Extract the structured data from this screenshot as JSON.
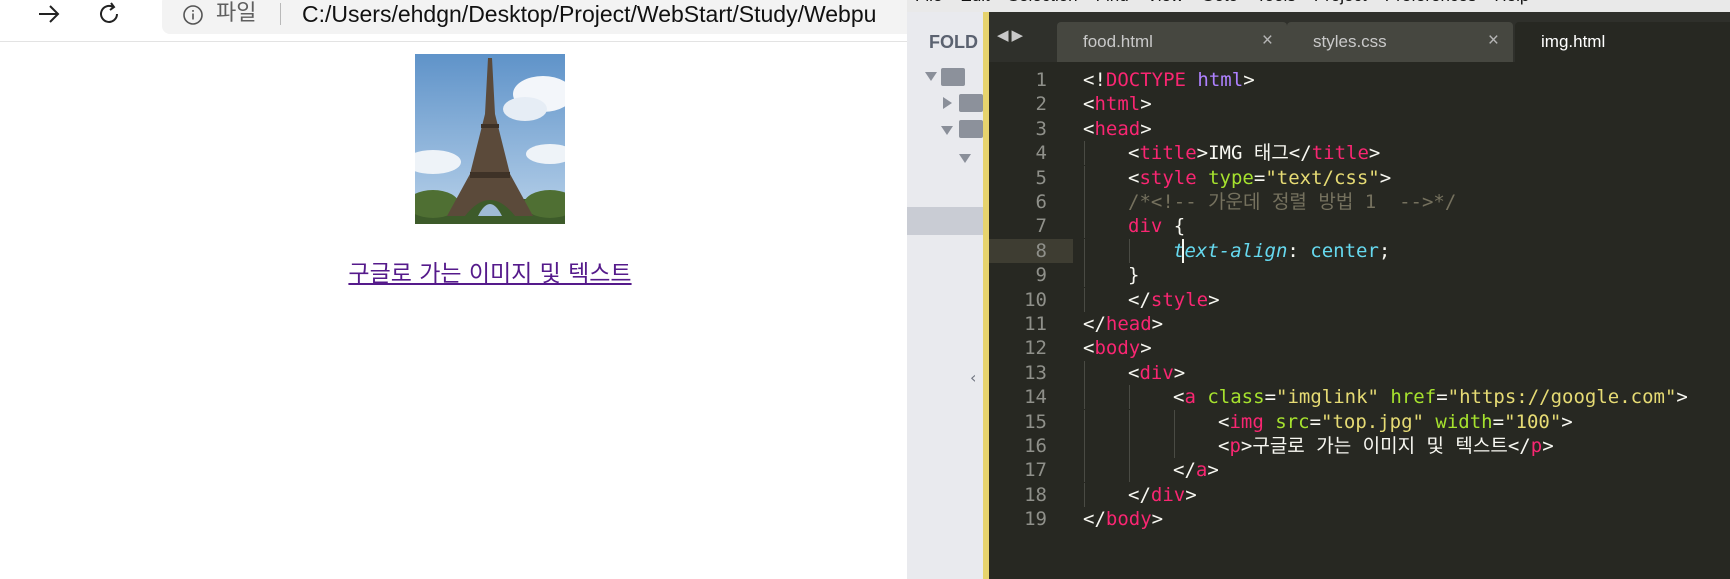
{
  "browser": {
    "address_scheme": "파일",
    "address_url": "C:/Users/ehdgn/Desktop/Project/WebStart/Study/Webpu",
    "page": {
      "image_alt": "Eiffel Tower photo",
      "link_text": "구글로 가는 이미지 및 텍스트"
    }
  },
  "editor": {
    "menu": [
      "File",
      "Edit",
      "Selection",
      "Find",
      "View",
      "Goto",
      "Tools",
      "Project",
      "Preferences",
      "Help"
    ],
    "sidebar": {
      "folders_label": "FOLD"
    },
    "tabs": [
      {
        "name": "food.html",
        "close": "×",
        "active": false
      },
      {
        "name": "styles.css",
        "close": "×",
        "active": false
      },
      {
        "name": "img.html",
        "close": "",
        "active": true
      }
    ],
    "current_line": 8,
    "code_lines": [
      {
        "n": "1",
        "indent": 0,
        "tokens": [
          [
            "p",
            "<!"
          ],
          [
            "tag",
            "DOCTYPE"
          ],
          [
            "p",
            " "
          ],
          [
            "doc",
            "html"
          ],
          [
            "p",
            ">"
          ]
        ]
      },
      {
        "n": "2",
        "indent": 0,
        "tokens": [
          [
            "p",
            "<"
          ],
          [
            "tag",
            "html"
          ],
          [
            "p",
            ">"
          ]
        ]
      },
      {
        "n": "3",
        "indent": 0,
        "tokens": [
          [
            "p",
            "<"
          ],
          [
            "tag",
            "head"
          ],
          [
            "p",
            ">"
          ]
        ]
      },
      {
        "n": "4",
        "indent": 1,
        "tokens": [
          [
            "p",
            "<"
          ],
          [
            "tag",
            "title"
          ],
          [
            "p",
            ">IMG 태그</"
          ],
          [
            "tag",
            "title"
          ],
          [
            "p",
            ">"
          ]
        ]
      },
      {
        "n": "5",
        "indent": 1,
        "tokens": [
          [
            "p",
            "<"
          ],
          [
            "tag",
            "style"
          ],
          [
            "p",
            " "
          ],
          [
            "attr",
            "type"
          ],
          [
            "p",
            "="
          ],
          [
            "str",
            "\"text/css\""
          ],
          [
            "p",
            ">"
          ]
        ]
      },
      {
        "n": "6",
        "indent": 1,
        "tokens": [
          [
            "cmt",
            "/*<!-- 가운데 정렬 방법 1  -->*/"
          ]
        ]
      },
      {
        "n": "7",
        "indent": 1,
        "tokens": [
          [
            "tag",
            "div"
          ],
          [
            "p",
            " {"
          ]
        ]
      },
      {
        "n": "8",
        "indent": 2,
        "tokens": [
          [
            "prop",
            "text-align"
          ],
          [
            "p",
            ": "
          ],
          [
            "kw",
            "center"
          ],
          [
            "p",
            ";"
          ]
        ]
      },
      {
        "n": "9",
        "indent": 1,
        "tokens": [
          [
            "p",
            "}"
          ]
        ]
      },
      {
        "n": "10",
        "indent": 1,
        "tokens": [
          [
            "p",
            "</"
          ],
          [
            "tag",
            "style"
          ],
          [
            "p",
            ">"
          ]
        ]
      },
      {
        "n": "11",
        "indent": 0,
        "tokens": [
          [
            "p",
            "</"
          ],
          [
            "tag",
            "head"
          ],
          [
            "p",
            ">"
          ]
        ]
      },
      {
        "n": "12",
        "indent": 0,
        "tokens": [
          [
            "p",
            "<"
          ],
          [
            "tag",
            "body"
          ],
          [
            "p",
            ">"
          ]
        ]
      },
      {
        "n": "13",
        "indent": 1,
        "tokens": [
          [
            "p",
            "<"
          ],
          [
            "tag",
            "div"
          ],
          [
            "p",
            ">"
          ]
        ]
      },
      {
        "n": "14",
        "indent": 2,
        "tokens": [
          [
            "p",
            "<"
          ],
          [
            "tag",
            "a"
          ],
          [
            "p",
            " "
          ],
          [
            "attr",
            "class"
          ],
          [
            "p",
            "="
          ],
          [
            "str",
            "\"imglink\""
          ],
          [
            "p",
            " "
          ],
          [
            "attr",
            "href"
          ],
          [
            "p",
            "="
          ],
          [
            "str",
            "\"https://google.com\""
          ],
          [
            "p",
            ">"
          ]
        ]
      },
      {
        "n": "15",
        "indent": 3,
        "tokens": [
          [
            "p",
            "<"
          ],
          [
            "tag",
            "img"
          ],
          [
            "p",
            " "
          ],
          [
            "attr",
            "src"
          ],
          [
            "p",
            "="
          ],
          [
            "str",
            "\"top.jpg\""
          ],
          [
            "p",
            " "
          ],
          [
            "attr",
            "width"
          ],
          [
            "p",
            "="
          ],
          [
            "str",
            "\"100\""
          ],
          [
            "p",
            ">"
          ]
        ]
      },
      {
        "n": "16",
        "indent": 3,
        "tokens": [
          [
            "p",
            "<"
          ],
          [
            "tag",
            "p"
          ],
          [
            "p",
            ">구글로 가는 이미지 및 텍스트</"
          ],
          [
            "tag",
            "p"
          ],
          [
            "p",
            ">"
          ]
        ]
      },
      {
        "n": "17",
        "indent": 2,
        "tokens": [
          [
            "p",
            "</"
          ],
          [
            "tag",
            "a"
          ],
          [
            "p",
            ">"
          ]
        ]
      },
      {
        "n": "18",
        "indent": 1,
        "tokens": [
          [
            "p",
            "</"
          ],
          [
            "tag",
            "div"
          ],
          [
            "p",
            ">"
          ]
        ]
      },
      {
        "n": "19",
        "indent": 0,
        "tokens": [
          [
            "p",
            "</"
          ],
          [
            "tag",
            "body"
          ],
          [
            "p",
            ">"
          ]
        ]
      }
    ]
  },
  "colors": {
    "editor_bg": "#272822",
    "tag": "#f92672",
    "attr": "#a6e22e",
    "string": "#e6db74",
    "comment": "#75715e",
    "keyword": "#66d9ef",
    "link_visited": "#551a8b"
  }
}
